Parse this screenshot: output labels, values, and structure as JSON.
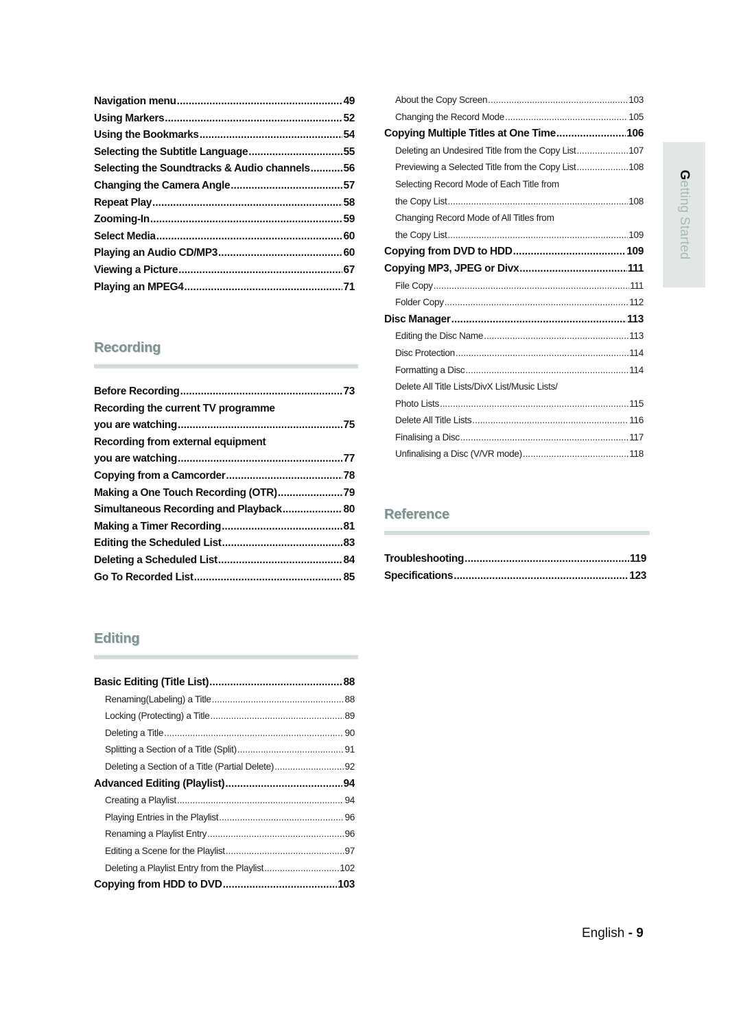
{
  "side_tab": {
    "first_letter": "G",
    "rest": "etting Started"
  },
  "left_column": {
    "playback_items": [
      {
        "title": "Navigation menu",
        "page": "49",
        "level": 1
      },
      {
        "title": "Using Markers",
        "page": "52",
        "level": 1
      },
      {
        "title": "Using the Bookmarks",
        "page": "54",
        "level": 1
      },
      {
        "title": "Selecting the Subtitle Language",
        "page": "55",
        "level": 1
      },
      {
        "title": "Selecting the Soundtracks & Audio channels",
        "page": "56",
        "level": 1
      },
      {
        "title": "Changing the Camera Angle",
        "page": "57",
        "level": 1
      },
      {
        "title": "Repeat Play",
        "page": "58",
        "level": 1
      },
      {
        "title": "Zooming-In",
        "page": "59",
        "level": 1
      },
      {
        "title": "Select Media",
        "page": "60",
        "level": 1
      },
      {
        "title": "Playing an Audio CD/MP3",
        "page": "60",
        "level": 1
      },
      {
        "title": "Viewing a Picture",
        "page": "67",
        "level": 1
      },
      {
        "title": "Playing an MPEG4",
        "page": "71",
        "level": 1
      }
    ],
    "recording": {
      "heading": "Recording",
      "items": [
        {
          "title": "Before Recording",
          "page": "73",
          "level": 1
        },
        {
          "title": "Recording the current TV programme",
          "page": "",
          "level": 1
        },
        {
          "title": "you are watching",
          "page": "75",
          "level": 1
        },
        {
          "title": "Recording from external equipment",
          "page": "",
          "level": 1
        },
        {
          "title": "you are watching",
          "page": "77",
          "level": 1
        },
        {
          "title": "Copying from a Camcorder",
          "page": "78",
          "level": 1
        },
        {
          "title": "Making a One Touch Recording (OTR)",
          "page": "79",
          "level": 1
        },
        {
          "title": "Simultaneous Recording and Playback",
          "page": "80",
          "level": 1
        },
        {
          "title": "Making a Timer Recording",
          "page": "81",
          "level": 1
        },
        {
          "title": "Editing the Scheduled List",
          "page": "83",
          "level": 1
        },
        {
          "title": "Deleting a Scheduled List",
          "page": "84",
          "level": 1
        },
        {
          "title": "Go To Recorded List",
          "page": "85",
          "level": 1
        }
      ]
    },
    "editing": {
      "heading": "Editing",
      "items": [
        {
          "title": "Basic Editing (Title List)",
          "page": "88",
          "level": 1
        },
        {
          "title": "Renaming(Labeling) a Title",
          "page": "88",
          "level": 2
        },
        {
          "title": "Locking (Protecting) a Title",
          "page": "89",
          "level": 2
        },
        {
          "title": "Deleting a Title",
          "page": "90",
          "level": 2
        },
        {
          "title": "Splitting a Section of a Title (Split)",
          "page": "91",
          "level": 2
        },
        {
          "title": "Deleting a Section of a Title (Partial Delete)",
          "page": "92",
          "level": 2
        },
        {
          "title": "Advanced Editing (Playlist)",
          "page": "94",
          "level": 1
        },
        {
          "title": "Creating a Playlist",
          "page": "94",
          "level": 2
        },
        {
          "title": "Playing Entries in the Playlist",
          "page": "96",
          "level": 2
        },
        {
          "title": "Renaming a Playlist Entry",
          "page": "96",
          "level": 2
        },
        {
          "title": "Editing a Scene for the Playlist",
          "page": "97",
          "level": 2
        },
        {
          "title": "Deleting a Playlist Entry from the Playlist",
          "page": "102",
          "level": 2
        },
        {
          "title": "Copying from HDD to DVD",
          "page": "103",
          "level": 1
        }
      ]
    }
  },
  "right_column": {
    "copy_items": [
      {
        "title": "About the Copy Screen",
        "page": "103",
        "level": 2
      },
      {
        "title": "Changing the Record Mode",
        "page": "105",
        "level": 2
      },
      {
        "title": "Copying Multiple Titles at One Time",
        "page": "106",
        "level": 1
      },
      {
        "title": "Deleting an Undesired Title from the Copy List",
        "page": "107",
        "level": 2
      },
      {
        "title": "Previewing a Selected Title from the Copy List",
        "page": "108",
        "level": 2
      },
      {
        "title": "Selecting Record Mode of Each Title from",
        "page": "",
        "level": 2
      },
      {
        "title": "the Copy List",
        "page": "108",
        "level": 2
      },
      {
        "title": "Changing Record Mode of All Titles from",
        "page": "",
        "level": 2
      },
      {
        "title": "the Copy List",
        "page": "109",
        "level": 2
      },
      {
        "title": "Copying from DVD to HDD",
        "page": "109",
        "level": 1
      },
      {
        "title": "Copying MP3, JPEG or Divx",
        "page": "111",
        "level": 1
      },
      {
        "title": "File Copy",
        "page": "111",
        "level": 2
      },
      {
        "title": "Folder Copy",
        "page": "112",
        "level": 2
      },
      {
        "title": "Disc Manager",
        "page": "113",
        "level": 1
      },
      {
        "title": "Editing the Disc Name",
        "page": "113",
        "level": 2
      },
      {
        "title": "Disc Protection",
        "page": "114",
        "level": 2
      },
      {
        "title": "Formatting a Disc",
        "page": "114",
        "level": 2
      },
      {
        "title": "Delete All Title Lists/DivX List/Music Lists/",
        "page": "",
        "level": 2
      },
      {
        "title": "Photo Lists",
        "page": "115",
        "level": 2
      },
      {
        "title": "Delete All Title Lists",
        "page": "116",
        "level": 2
      },
      {
        "title": "Finalising a Disc",
        "page": "117",
        "level": 2
      },
      {
        "title": "Unfinalising a Disc (V/VR mode)",
        "page": "118",
        "level": 2
      }
    ],
    "reference": {
      "heading": "Reference",
      "items": [
        {
          "title": "Troubleshooting",
          "page": "119",
          "level": 1
        },
        {
          "title": "Specifications",
          "page": "123",
          "level": 1
        }
      ]
    }
  },
  "footer": {
    "language": "English",
    "separator": " - ",
    "page_number": "9"
  },
  "colors": {
    "section_heading": "#7f9191",
    "section_rule": "#d4ddd9",
    "side_tab_bg": "#e2e6e5",
    "side_tab_text": "#a8b9b9"
  }
}
